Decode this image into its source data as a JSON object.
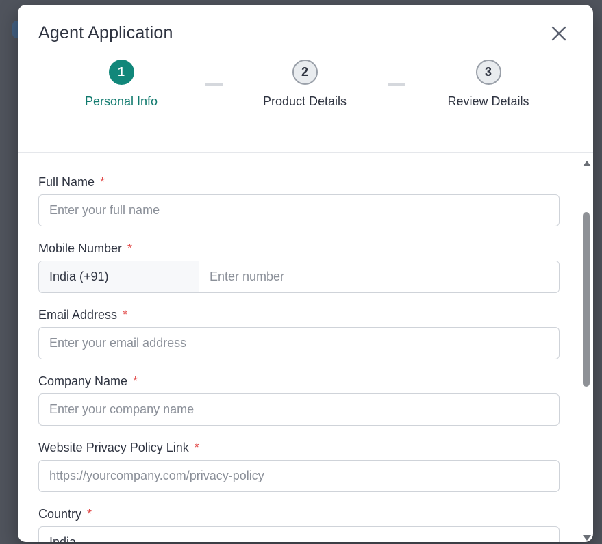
{
  "modal": {
    "title": "Agent Application",
    "close_icon": "close-icon"
  },
  "stepper": {
    "steps": [
      {
        "number": "1",
        "label": "Personal Info",
        "state": "active"
      },
      {
        "number": "2",
        "label": "Product Details",
        "state": "inactive"
      },
      {
        "number": "3",
        "label": "Review Details",
        "state": "inactive"
      }
    ]
  },
  "form": {
    "full_name": {
      "label": "Full Name",
      "required": "*",
      "placeholder": "Enter your full name",
      "value": ""
    },
    "mobile_number": {
      "label": "Mobile Number",
      "required": "*",
      "country_code": "India (+91)",
      "placeholder": "Enter number",
      "value": ""
    },
    "email": {
      "label": "Email Address",
      "required": "*",
      "placeholder": "Enter your email address",
      "value": ""
    },
    "company_name": {
      "label": "Company Name",
      "required": "*",
      "placeholder": "Enter your company name",
      "value": ""
    },
    "privacy_link": {
      "label": "Website Privacy Policy Link",
      "required": "*",
      "placeholder": "https://yourcompany.com/privacy-policy",
      "value": ""
    },
    "country": {
      "label": "Country",
      "required": "*",
      "value": "India"
    }
  },
  "colors": {
    "accent": "#11877a",
    "required": "#e24c4b",
    "text": "#2f3441"
  }
}
